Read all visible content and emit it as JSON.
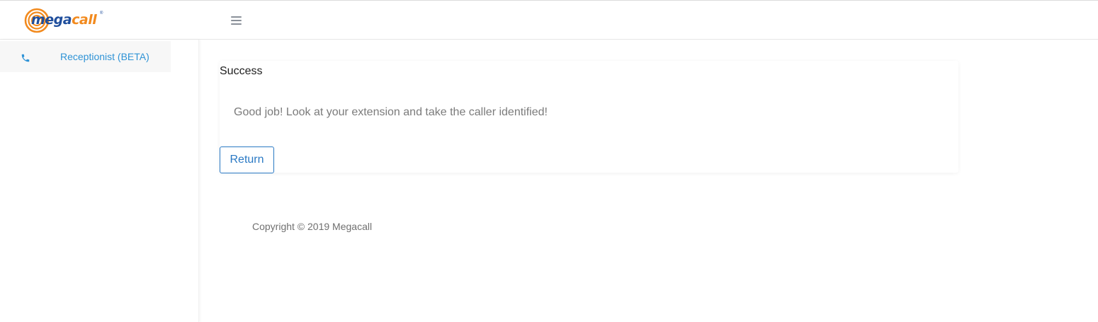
{
  "header": {
    "logo": {
      "part1": "mega",
      "part2": "call",
      "reg": "®"
    },
    "menu_icon": "hamburger-menu-icon"
  },
  "sidebar": {
    "items": [
      {
        "label": "Receptionist (BETA)",
        "icon": "phone-icon",
        "active": true
      }
    ]
  },
  "card": {
    "title": "Success",
    "message": "Good job! Look at your extension and take the caller identified!",
    "return_label": "Return"
  },
  "footer": {
    "copyright": "Copyright © 2019 Megacall"
  },
  "colors": {
    "brand_blue": "#1f4e9c",
    "brand_orange": "#f28a1e",
    "link_blue": "#2f93d6",
    "button_blue": "#2a79c4"
  }
}
